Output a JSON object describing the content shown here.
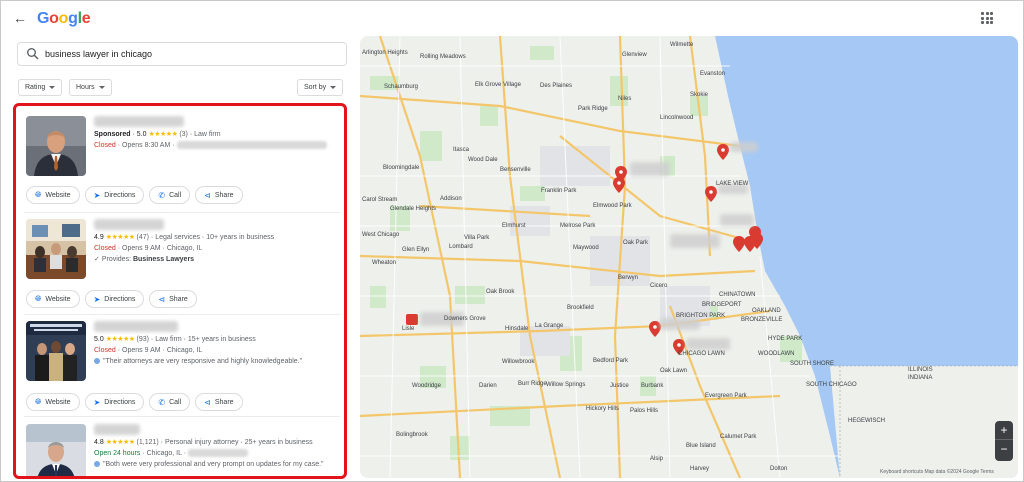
{
  "header": {
    "back_icon": "arrow-left-icon",
    "logo": "Google",
    "apps_icon": "apps-grid-icon"
  },
  "search": {
    "query": "business lawyer in chicago"
  },
  "filters": {
    "rating": "Rating",
    "hours": "Hours",
    "sort": "Sort by"
  },
  "results": [
    {
      "sponsored": "Sponsored",
      "rating": "5.0",
      "stars": "★★★★★",
      "reviews": "(3)",
      "category": "Law firm",
      "status": "Closed",
      "hours": "Opens 8:30 AM",
      "actions": [
        "Website",
        "Directions",
        "Call",
        "Share"
      ]
    },
    {
      "rating": "4.9",
      "stars": "★★★★★",
      "reviews": "(47)",
      "category": "Legal services",
      "years": "10+ years in business",
      "status": "Closed",
      "hours": "Opens 9 AM",
      "city": "Chicago, IL",
      "provides_label": "Provides:",
      "provides": "Business Lawyers",
      "actions": [
        "Website",
        "Directions",
        "Share"
      ]
    },
    {
      "rating": "5.0",
      "stars": "★★★★★",
      "reviews": "(93)",
      "category": "Law firm",
      "years": "15+ years in business",
      "status": "Closed",
      "hours": "Opens 9 AM",
      "city": "Chicago, IL",
      "quote": "\"Their attorneys are very responsive and highly knowledgeable.\"",
      "actions": [
        "Website",
        "Directions",
        "Call",
        "Share"
      ]
    },
    {
      "rating": "4.8",
      "stars": "★★★★★",
      "reviews": "(1,121)",
      "category": "Personal injury attorney",
      "years": "25+ years in business",
      "status": "Open 24 hours",
      "city": "Chicago, IL",
      "quote": "\"Both were very professional and very prompt on updates for my case.\""
    }
  ],
  "map": {
    "labels": {
      "arlington_heights": "Arlington Heights",
      "wilmette": "Wilmette",
      "glenview": "Glenview",
      "evanston": "Evanston",
      "rolling_meadows": "Rolling Meadows",
      "elk_grove_village": "Elk Grove Village",
      "des_plaines": "Des Plaines",
      "park_ridge": "Park Ridge",
      "niles": "Niles",
      "skokie": "Skokie",
      "lincolnwood": "Lincolnwood",
      "schaumburg": "Schaumburg",
      "itasca": "Itasca",
      "wood_dale": "Wood Dale",
      "bensenville": "Bensenville",
      "bloomingdale": "Bloomingdale",
      "franklin_park": "Franklin Park",
      "elmwood_park": "Elmwood Park",
      "lake_view": "LAKE VIEW",
      "addison": "Addison",
      "glendale_heights": "Glendale Heights",
      "carol_stream": "Carol Stream",
      "west_chicago": "West Chicago",
      "glen_ellyn": "Glen Ellyn",
      "villa_park": "Villa Park",
      "elmhurst": "Elmhurst",
      "melrose_park": "Melrose Park",
      "oak_park": "Oak Park",
      "maywood": "Maywood",
      "lombard": "Lombard",
      "wheaton": "Wheaton",
      "berwyn": "Berwyn",
      "cicero": "Cicero",
      "lisle": "Lisle",
      "downers_grove": "Downers Grove",
      "oak_brook": "Oak Brook",
      "hinsdale": "Hinsdale",
      "brookfield": "Brookfield",
      "la_grange": "La Grange",
      "chinatown": "CHINATOWN",
      "bridgeport": "BRIDGEPORT",
      "oakland": "OAKLAND",
      "bronzeville": "BRONZEVILLE",
      "hyde_park": "HYDE PARK",
      "woodlawn": "WOODLAWN",
      "south_shore": "SOUTH SHORE",
      "south_chicago": "SOUTH CHICAGO",
      "brighton_park": "BRIGHTON PARK",
      "chicago_lawn": "CHICAGO LAWN",
      "willowbrook": "Willowbrook",
      "burr_ridge": "Burr Ridge",
      "bedford_park": "Bedford Park",
      "oak_lawn": "Oak Lawn",
      "burbank": "Burbank",
      "woodridge": "Woodridge",
      "darien": "Darien",
      "willow_springs": "Willow Springs",
      "justice": "Justice",
      "hickory_hills": "Hickory Hills",
      "palos_hills": "Palos Hills",
      "evergreen_park": "Evergreen Park",
      "bolingbrook": "Bolingbrook",
      "calumet_park": "Calumet Park",
      "blue_island": "Blue Island",
      "alsip": "Alsip",
      "harvey": "Harvey",
      "dolton": "Dolton",
      "illinois": "ILLINOIS",
      "indiana": "INDIANA",
      "hegewisch": "HEGEWISCH"
    },
    "zoom_in": "+",
    "zoom_out": "−",
    "attribution": "Keyboard shortcuts   Map data ©2024 Google   Terms"
  }
}
